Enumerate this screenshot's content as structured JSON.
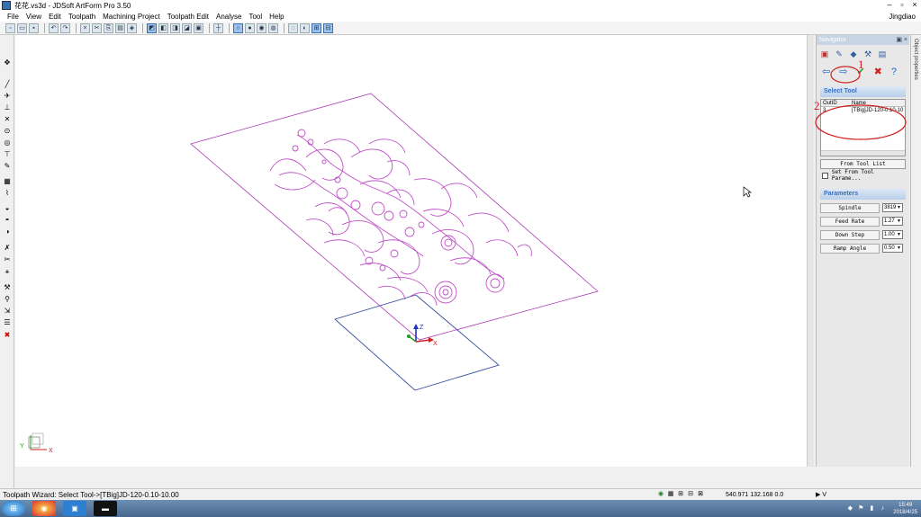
{
  "window": {
    "title": "花花.vs3d - JDSoft ArtForm Pro 3.50",
    "user": "Jingdiao"
  },
  "menu": [
    "File",
    "View",
    "Edit",
    "Toolpath",
    "Machining Project",
    "Toolpath Edit",
    "Analyse",
    "Tool",
    "Help"
  ],
  "navigator": {
    "title": "Navigator",
    "object_properties_tab": "Object properties",
    "select_tool": {
      "heading": "Select Tool",
      "columns": [
        "OutID",
        "Name"
      ],
      "rows": [
        {
          "out_id": "3",
          "name": "[TBig]JD-120-0.10-10"
        }
      ],
      "from_tool_list": "From Tool List",
      "set_from_tool_params": "Set From Tool Parame..."
    },
    "parameters": {
      "heading": "Parameters",
      "items": [
        {
          "label": "Spindle",
          "value": "3819"
        },
        {
          "label": "Feed Rate",
          "value": "1.27"
        },
        {
          "label": "Down Step",
          "value": "1.00"
        },
        {
          "label": "Ramp Angle",
          "value": "0.50"
        }
      ]
    }
  },
  "annotations": {
    "marker1": "1",
    "marker2": "2"
  },
  "axes": {
    "x": "X",
    "y": "Y",
    "z": "Z"
  },
  "status": {
    "message": "Toolpath Wizard: Select Tool->[TBig]JD-120-0.10-10.00",
    "coords": "540.971 132.168 0.0",
    "view_selector": "V"
  },
  "taskbar": {
    "time": "15:49",
    "date": "2018/4/25"
  },
  "colors": {
    "pattern": "#c050c8",
    "plate": "#b03cb8",
    "workplane": "#3a4fa0",
    "annotation": "#d02020"
  }
}
